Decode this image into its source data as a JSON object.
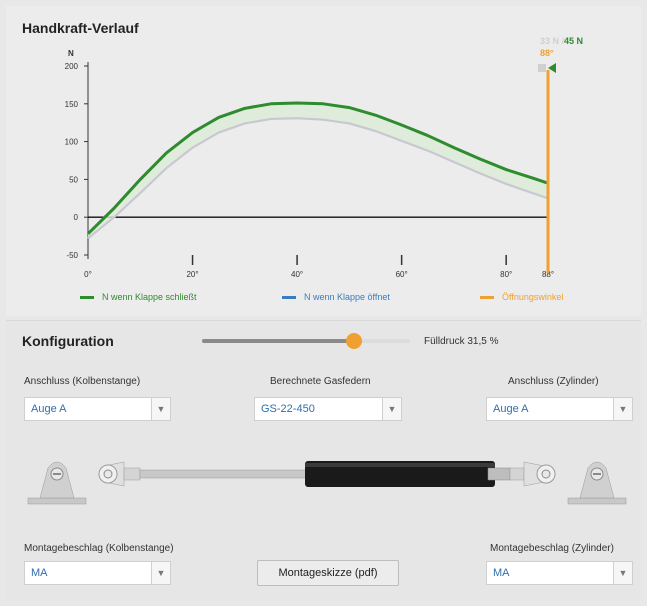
{
  "chart": {
    "title": "Handkraft-Verlauf",
    "y_unit": "N",
    "readout_prefix": "33 N /",
    "readout_value": "45 N",
    "readout_angle": "88°",
    "legend": [
      {
        "label": "N wenn Klappe schließt",
        "color": "#2e8b2e"
      },
      {
        "label": "N wenn Klappe öffnet",
        "color": "#3a7cc0"
      },
      {
        "label": "Öffnungswinkel",
        "color": "#f0a030"
      }
    ]
  },
  "chart_data": {
    "type": "line",
    "title": "Handkraft-Verlauf",
    "xlabel": "",
    "ylabel": "N",
    "xlim": [
      0,
      88
    ],
    "ylim": [
      -50,
      200
    ],
    "x_ticks": [
      "0°",
      "20°",
      "40°",
      "60°",
      "80°",
      "88°"
    ],
    "y_ticks": [
      "200",
      "150",
      "100",
      "50",
      "0",
      "-50"
    ],
    "series": [
      {
        "name": "N wenn Klappe schließt",
        "color": "#2e8b2e",
        "x": [
          0,
          5,
          10,
          15,
          20,
          25,
          30,
          35,
          40,
          45,
          50,
          55,
          60,
          65,
          70,
          75,
          80,
          85,
          88
        ],
        "y": [
          -22,
          12,
          50,
          85,
          112,
          132,
          144,
          150,
          151,
          150,
          145,
          135,
          122,
          108,
          92,
          77,
          63,
          52,
          45
        ]
      },
      {
        "name": "N wenn Klappe öffnet",
        "color": "#c8c8d0",
        "x": [
          0,
          5,
          10,
          15,
          20,
          25,
          30,
          35,
          40,
          45,
          50,
          55,
          60,
          65,
          70,
          75,
          80,
          85,
          88
        ],
        "y": [
          -28,
          0,
          32,
          65,
          92,
          112,
          124,
          130,
          131,
          129,
          124,
          114,
          101,
          88,
          73,
          58,
          44,
          32,
          25
        ]
      }
    ],
    "vline": {
      "x": 88,
      "name": "Öffnungswinkel",
      "color": "#f0a030"
    },
    "grid": false
  },
  "config": {
    "title": "Konfiguration",
    "fill_label": "Fülldruck 31,5 %",
    "fill_value": 0.73,
    "anschluss_kolben_label": "Anschluss (Kolbenstange)",
    "anschluss_kolben_value": "Auge A",
    "gasfeder_label": "Berechnete Gasfedern",
    "gasfeder_value": "GS-22-450",
    "anschluss_zyl_label": "Anschluss (Zylinder)",
    "anschluss_zyl_value": "Auge A",
    "montage_kolben_label": "Montagebeschlag (Kolbenstange)",
    "montage_kolben_value": "MA",
    "skizze_button": "Montageskizze (pdf)",
    "montage_zyl_label": "Montagebeschlag (Zylinder)",
    "montage_zyl_value": "MA"
  },
  "icons": {
    "dropdown": "chevron-down-icon"
  }
}
